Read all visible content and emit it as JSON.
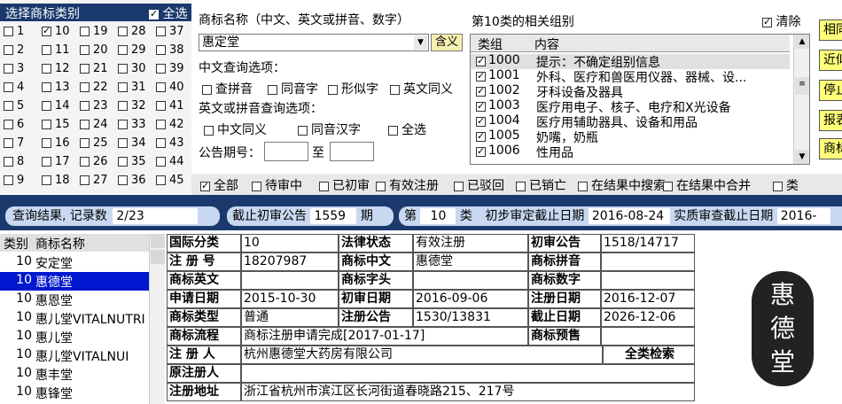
{
  "category_panel": {
    "title": "选择商标类别",
    "select_all_label": "全选",
    "select_all_checked": true,
    "checked": [
      "10"
    ],
    "columns": [
      [
        "1",
        "2",
        "3",
        "4",
        "5",
        "6",
        "7",
        "8",
        "9"
      ],
      [
        "10",
        "11",
        "12",
        "13",
        "14",
        "15",
        "16",
        "17",
        "18"
      ],
      [
        "19",
        "20",
        "21",
        "22",
        "23",
        "24",
        "25",
        "26",
        "27"
      ],
      [
        "28",
        "29",
        "30",
        "31",
        "32",
        "33",
        "34",
        "35",
        "36"
      ],
      [
        "37",
        "38",
        "39",
        "40",
        "41",
        "42",
        "43",
        "44",
        "45"
      ]
    ]
  },
  "query": {
    "name_label": "商标名称（中文、英文或拼音、数字）",
    "name_value": "惠定堂",
    "meaning_button": "含义",
    "cn_options_label": "中文查询选项：",
    "cn_options": [
      "查拼音",
      "同音字",
      "形似字",
      "英文同义"
    ],
    "en_options_label": "英文或拼音查询选项：",
    "en_options": [
      "中文同义",
      "同音汉字",
      "全选"
    ],
    "gazette_label": "公告期号：",
    "gazette_to": "至"
  },
  "groups": {
    "title": "第10类的相关组别",
    "clear_label": "清除",
    "clear_checked": true,
    "col_group": "类组",
    "col_content": "内容",
    "rows": [
      {
        "code": "1000",
        "content": "提示：不确定组别信息",
        "checked": true
      },
      {
        "code": "1001",
        "content": "外科、医疗和兽医用仪器、器械、设...",
        "checked": true
      },
      {
        "code": "1002",
        "content": "牙科设备及器具",
        "checked": true
      },
      {
        "code": "1003",
        "content": "医疗用电子、核子、电疗和X光设备",
        "checked": true
      },
      {
        "code": "1004",
        "content": "医疗用辅助器具、设备和用品",
        "checked": true
      },
      {
        "code": "1005",
        "content": "奶嘴，奶瓶",
        "checked": true
      },
      {
        "code": "1006",
        "content": "性用品",
        "checked": true
      }
    ]
  },
  "side_buttons": [
    "相同",
    "近似",
    "停止",
    "报表",
    "商标"
  ],
  "filters": {
    "items": [
      {
        "label": "全部",
        "checked": true
      },
      {
        "label": "待审中",
        "checked": false
      },
      {
        "label": "已初审",
        "checked": false
      },
      {
        "label": "有效注册",
        "checked": false
      },
      {
        "label": "已驳回",
        "checked": false
      },
      {
        "label": "已销亡",
        "checked": false
      },
      {
        "label": "在结果中搜索",
        "checked": false
      },
      {
        "label": "在结果中合并",
        "checked": false
      },
      {
        "label": "类",
        "checked": false
      }
    ]
  },
  "result_bar": {
    "count_label": "查询结果, 记录数",
    "count_value": "2/23",
    "deadline_label": "截止初审公告",
    "deadline_value": "1559",
    "deadline_unit": "期",
    "class_prefix": "第",
    "class_value": "10",
    "class_suffix": "类",
    "prelim_label": "初步审定截止日期",
    "prelim_value": "2016-08-24",
    "exam_label": "实质审查截止日期",
    "exam_value": "2016-"
  },
  "results": {
    "col_class": "类别",
    "col_name": "商标名称",
    "rows": [
      {
        "cls": "10",
        "name": "安定堂"
      },
      {
        "cls": "10",
        "name": "惠德堂"
      },
      {
        "cls": "10",
        "name": "惠恩堂"
      },
      {
        "cls": "10",
        "name": "惠儿堂VITALNUTRI"
      },
      {
        "cls": "10",
        "name": "惠儿堂"
      },
      {
        "cls": "10",
        "name": "惠儿堂VITALNUI"
      },
      {
        "cls": "10",
        "name": "惠丰堂"
      },
      {
        "cls": "10",
        "name": "惠锋堂"
      }
    ]
  },
  "detail": {
    "intl_class_label": "国际分类",
    "intl_class": "10",
    "legal_status_label": "法律状态",
    "legal_status": "有效注册",
    "prelim_gazette_label": "初审公告",
    "prelim_gazette": "1518/14717",
    "reg_no_label": "注 册 号",
    "reg_no": "18207987",
    "cn_name_label": "商标中文",
    "cn_name": "惠德堂",
    "pinyin_label": "商标拼音",
    "pinyin": "",
    "en_name_label": "商标英文",
    "en_name": "",
    "initials_label": "商标字头",
    "initials": "",
    "digits_label": "商标数字",
    "digits": "",
    "apply_date_label": "申请日期",
    "apply_date": "2015-10-30",
    "prelim_date_label": "初审日期",
    "prelim_date": "2016-09-06",
    "reg_date_label": "注册日期",
    "reg_date": "2016-12-07",
    "type_label": "商标类型",
    "type": "普通",
    "reg_gazette_label": "注册公告",
    "reg_gazette": "1530/13831",
    "expire_label": "截止日期",
    "expire": "2026-12-06",
    "flow_label": "商标流程",
    "flow": "商标注册申请完成[2017-01-17]",
    "presale_label": "商标预售",
    "presale": "",
    "registrant_label": "注 册 人",
    "registrant": "杭州惠德堂大药房有限公司",
    "all_class_search": "全类检索",
    "orig_registrant_label": "原注册人",
    "orig_registrant": "",
    "address_label": "注册地址",
    "address": "浙江省杭州市滨江区长河街道春晓路215、217号"
  },
  "logo": {
    "text": "惠德堂"
  }
}
